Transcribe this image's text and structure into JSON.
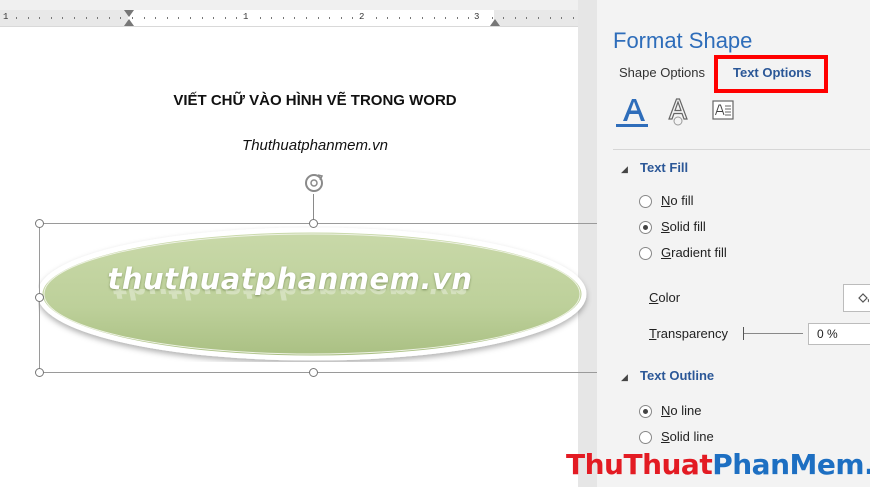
{
  "ruler": {
    "marks": [
      "1",
      "1",
      "2",
      "3"
    ]
  },
  "document": {
    "title": "VIẾT CHỮ VÀO HÌNH VẼ TRONG WORD",
    "subtitle": "Thuthuatphanmem.vn",
    "shape_text": "thuthuatphanmem.vn",
    "shape_fill": "#bdd09a",
    "shape_edge": "#ffffff"
  },
  "panel": {
    "title": "Format Shape",
    "tabs": {
      "shape_options": "Shape Options",
      "text_options": "Text Options"
    },
    "icons": [
      "text-fill-outline-icon",
      "text-effects-icon",
      "textbox-layout-icon"
    ],
    "text_fill": {
      "heading": "Text Fill",
      "options": [
        {
          "hotkey": "N",
          "rest": "o fill",
          "selected": false
        },
        {
          "hotkey": "S",
          "rest": "olid fill",
          "selected": true
        },
        {
          "hotkey": "G",
          "rest": "radient fill",
          "selected": false
        }
      ],
      "color_hotkey": "C",
      "color_rest": "olor",
      "transparency_hotkey": "T",
      "transparency_rest": "ransparency",
      "transparency_value": "0 %"
    },
    "text_outline": {
      "heading": "Text Outline",
      "options": [
        {
          "hotkey": "N",
          "rest": "o line",
          "selected": true
        },
        {
          "hotkey": "S",
          "rest": "olid line",
          "selected": false
        }
      ]
    },
    "accent_color": "#2e6dba",
    "highlight_color": "#ff0000"
  },
  "watermark": {
    "part1": "ThuThuat",
    "part2": "PhanMem.vn"
  }
}
